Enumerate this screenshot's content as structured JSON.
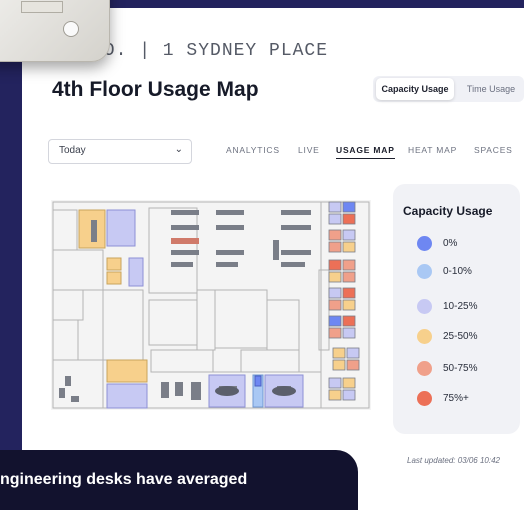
{
  "header": {
    "company": "CO. | 1 SYDNEY PLACE",
    "title": "4th Floor Usage Map"
  },
  "view_toggle": {
    "options": [
      "Capacity Usage",
      "Time Usage"
    ],
    "selected": "Capacity Usage"
  },
  "date_select": {
    "value": "Today"
  },
  "nav": {
    "items": [
      "ANALYTICS",
      "LIVE",
      "USAGE MAP",
      "HEAT MAP",
      "SPACES"
    ],
    "active": "USAGE MAP"
  },
  "legend": {
    "title": "Capacity Usage",
    "items": [
      {
        "label": "0%",
        "color": "#6e87f2"
      },
      {
        "label": "0-10%",
        "color": "#a9c8f4"
      },
      {
        "label": "10-25%",
        "color": "#c7c9f3"
      },
      {
        "label": "25-50%",
        "color": "#f7d08c"
      },
      {
        "label": "50-75%",
        "color": "#f0a08a"
      },
      {
        "label": "75%+",
        "color": "#ec7057"
      }
    ]
  },
  "last_updated": "Last updated: 03/06 10:42",
  "toast": {
    "text": "ngineering desks have averaged"
  },
  "device": {
    "icon": "sensor-device-icon"
  }
}
